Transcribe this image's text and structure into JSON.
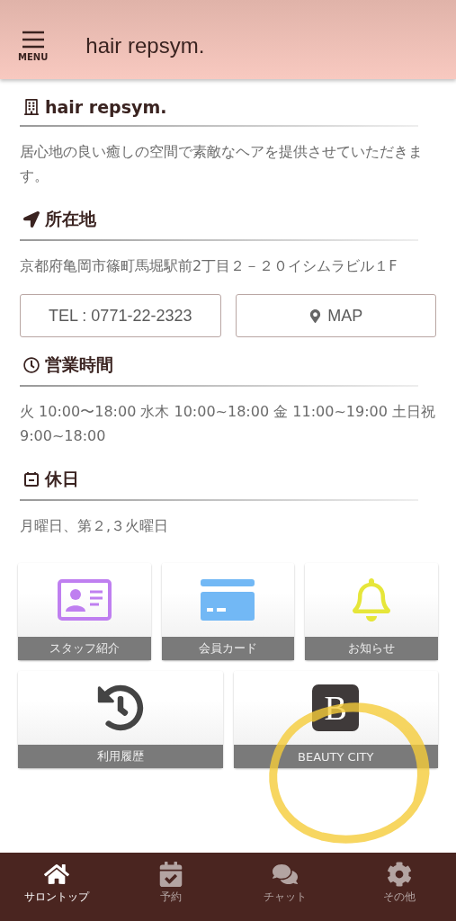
{
  "header": {
    "menu_label": "MENU",
    "title": "hair repsym."
  },
  "sections": [
    {
      "kind": "building",
      "heading": "hair repsym.",
      "text": "居心地の良い癒しの空間で素敵なヘアを提供させていただきます。"
    },
    {
      "kind": "location",
      "heading": "所在地",
      "text": "京都府亀岡市篠町馬堀駅前2丁目２－２０イシムラビル１F",
      "buttons": [
        {
          "kind": "phone",
          "label": "TEL : 0771-22-2323"
        },
        {
          "kind": "map",
          "label": "MAP"
        }
      ]
    },
    {
      "kind": "clock",
      "heading": "営業時間",
      "text": "火 10:00〜18:00 水木 10:00~18:00 金 11:00~19:00 土日祝 9:00~18:00"
    },
    {
      "kind": "calendar",
      "heading": "休日",
      "text": "月曜日、第２,３火曜日"
    }
  ],
  "tiles": [
    {
      "kind": "staff",
      "label": "スタッフ紹介"
    },
    {
      "kind": "card",
      "label": "会員カード"
    },
    {
      "kind": "bell",
      "label": "お知らせ"
    },
    {
      "kind": "history",
      "label": "利用履歴"
    },
    {
      "kind": "brand",
      "label": "BEAUTY CITY",
      "logo_letter": "B",
      "highlighted": true
    }
  ],
  "bottom_nav": [
    {
      "kind": "home",
      "label": "サロントップ",
      "selected": true
    },
    {
      "kind": "reserve",
      "label": "予約",
      "selected": false
    },
    {
      "kind": "chat",
      "label": "チャット",
      "selected": false
    },
    {
      "kind": "other",
      "label": "その他",
      "selected": false
    }
  ]
}
